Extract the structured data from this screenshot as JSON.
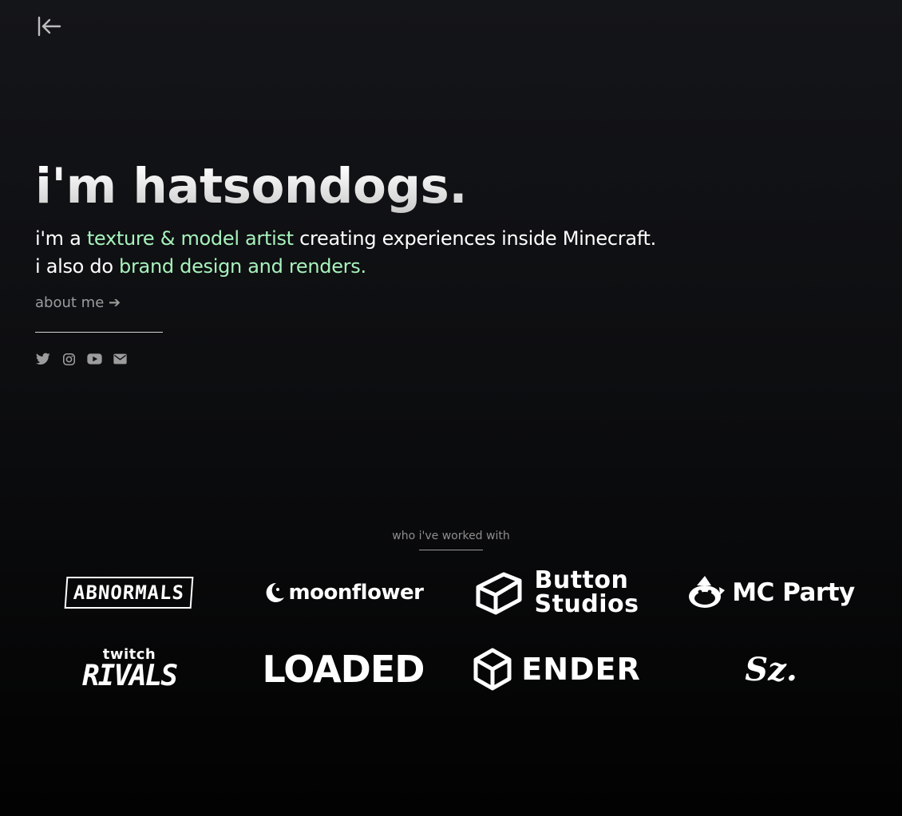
{
  "nav": {
    "back_icon": "collapse-left-arrow-icon"
  },
  "hero": {
    "title": "i'm hatsondogs.",
    "tagline": {
      "l1_prefix": "i'm a ",
      "l1_highlight": "texture & model artist",
      "l1_suffix": " creating experiences inside Minecraft.",
      "l2_prefix": "i also do ",
      "l2_highlight": "brand design and renders."
    },
    "about_link": "about me ➔",
    "socials": [
      {
        "icon": "twitter-icon"
      },
      {
        "icon": "instagram-icon"
      },
      {
        "icon": "youtube-icon"
      },
      {
        "icon": "email-icon"
      }
    ]
  },
  "worked_with": {
    "label": "who i've worked with",
    "logos": [
      {
        "name": "ABNORMALS"
      },
      {
        "name": "moonflower"
      },
      {
        "name_l1": "Button",
        "name_l2": "Studios"
      },
      {
        "name": "MC Party"
      },
      {
        "name_l1": "twitch",
        "name_l2": "RIVALS"
      },
      {
        "name": "LOADED"
      },
      {
        "name": "ENDER"
      },
      {
        "name": "Sz."
      }
    ]
  },
  "colors": {
    "accent_green": "#a7f2bd",
    "muted_text": "#9c9c9c",
    "background_top": "#141519",
    "background_bottom": "#020202"
  }
}
